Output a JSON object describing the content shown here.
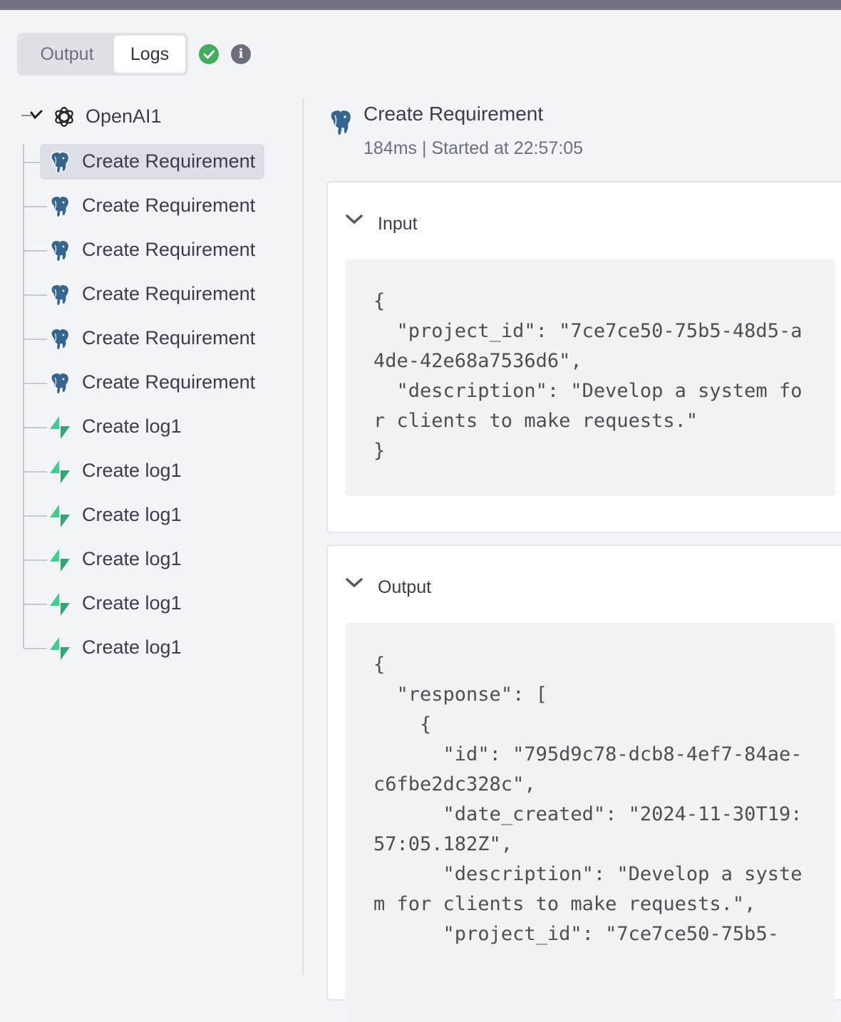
{
  "tabs": {
    "output": "Output",
    "logs": "Logs"
  },
  "tree": {
    "root": "OpenAI1",
    "items": [
      {
        "label": "Create Requirement",
        "icon": "postgres-elephant-icon"
      },
      {
        "label": "Create Requirement",
        "icon": "postgres-elephant-icon"
      },
      {
        "label": "Create Requirement",
        "icon": "postgres-elephant-icon"
      },
      {
        "label": "Create Requirement",
        "icon": "postgres-elephant-icon"
      },
      {
        "label": "Create Requirement",
        "icon": "postgres-elephant-icon"
      },
      {
        "label": "Create Requirement",
        "icon": "postgres-elephant-icon"
      },
      {
        "label": "Create log1",
        "icon": "supabase-bolt-icon"
      },
      {
        "label": "Create log1",
        "icon": "supabase-bolt-icon"
      },
      {
        "label": "Create log1",
        "icon": "supabase-bolt-icon"
      },
      {
        "label": "Create log1",
        "icon": "supabase-bolt-icon"
      },
      {
        "label": "Create log1",
        "icon": "supabase-bolt-icon"
      },
      {
        "label": "Create log1",
        "icon": "supabase-bolt-icon"
      }
    ]
  },
  "detail": {
    "title": "Create Requirement",
    "meta": "184ms | Started at 22:57:05",
    "input_label": "Input",
    "input_json": "{\n  \"project_id\": \"7ce7ce50-75b5-48d5-a4de-42e68a7536d6\",\n  \"description\": \"Develop a system for clients to make requests.\"\n}",
    "output_label": "Output",
    "output_json": "{\n  \"response\": [\n    {\n      \"id\": \"795d9c78-dcb8-4ef7-84ae-c6fbe2dc328c\",\n      \"date_created\": \"2024-11-30T19:57:05.182Z\",\n      \"description\": \"Develop a system for clients to make requests.\",\n      \"project_id\": \"7ce7ce50-75b5-"
  },
  "colors": {
    "success": "#3fae5e",
    "postgres": "#336791",
    "supabase": "#3ecf8e"
  }
}
